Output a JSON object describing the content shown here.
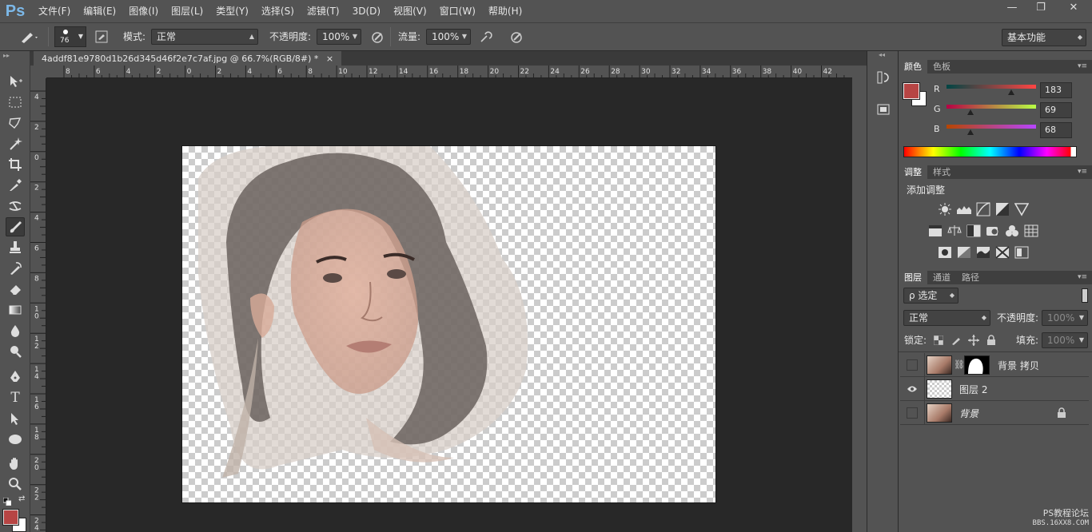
{
  "app": {
    "logo": "Ps"
  },
  "menu": [
    "文件(F)",
    "编辑(E)",
    "图像(I)",
    "图层(L)",
    "类型(Y)",
    "选择(S)",
    "滤镜(T)",
    "3D(D)",
    "视图(V)",
    "窗口(W)",
    "帮助(H)"
  ],
  "window_controls": {
    "minimize": "—",
    "restore": "❐",
    "close": "✕"
  },
  "options": {
    "brush_size": "76",
    "mode_label": "模式:",
    "mode_value": "正常",
    "opacity_label": "不透明度:",
    "opacity_value": "100%",
    "flow_label": "流量:",
    "flow_value": "100%",
    "workspace": "基本功能"
  },
  "document": {
    "tab_title": "4addf81e9780d1b26d345d46f2e7c7af.jpg @ 66.7%(RGB/8#) *",
    "tab_close": "×",
    "ruler_h": [
      "8",
      "6",
      "4",
      "2",
      "0",
      "2",
      "4",
      "6",
      "8",
      "10",
      "12",
      "14",
      "16",
      "18",
      "20",
      "22",
      "24",
      "26",
      "28",
      "30",
      "32",
      "34",
      "36",
      "38",
      "40",
      "42"
    ],
    "ruler_v": [
      "4",
      "2",
      "0",
      "2",
      "4",
      "6",
      "8",
      "1\n0",
      "1\n2",
      "1\n4",
      "1\n6",
      "1\n8",
      "2\n0",
      "2\n2",
      "2\n4"
    ]
  },
  "color_panel": {
    "tabs": [
      "颜色",
      "色板"
    ],
    "r_label": "R",
    "r_value": "183",
    "g_label": "G",
    "g_value": "69",
    "b_label": "B",
    "b_value": "68",
    "r_fraction": 0.72,
    "g_fraction": 0.27,
    "b_fraction": 0.27,
    "foreground": "#b74544",
    "background": "#ffffff"
  },
  "adjust_panel": {
    "tabs": [
      "调整",
      "样式"
    ],
    "title": "添加调整"
  },
  "layers_panel": {
    "tabs": [
      "图层",
      "通道",
      "路径"
    ],
    "filter_label": "ρ 选定",
    "blend_mode": "正常",
    "opacity_label": "不透明度:",
    "opacity_value": "100%",
    "lock_label": "锁定:",
    "fill_label": "填充:",
    "fill_value": "100%",
    "layers": [
      {
        "name": "背景 拷贝",
        "visible": false
      },
      {
        "name": "图层 2",
        "visible": true
      },
      {
        "name": "背景",
        "visible": false,
        "locked": true
      }
    ]
  },
  "watermark": {
    "line1": "PS教程论坛",
    "line2": "BBS.16XX8.COM"
  }
}
